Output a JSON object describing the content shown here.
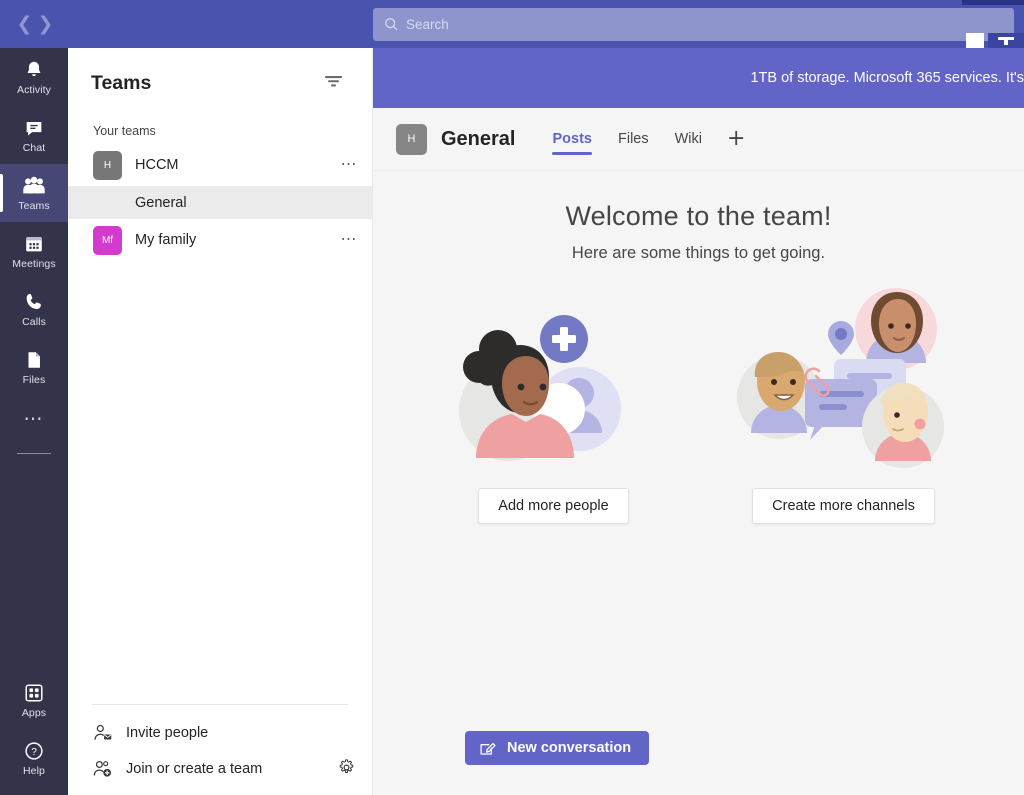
{
  "titlebar": {
    "back_icon": "chevron-left-icon",
    "forward_icon": "chevron-right-icon",
    "search_placeholder": "Search",
    "search_value": "",
    "search_icon": "search-icon"
  },
  "rail": {
    "items": [
      {
        "label": "Activity",
        "icon": "bell-icon",
        "selected": false
      },
      {
        "label": "Chat",
        "icon": "chat-bubble-icon",
        "selected": false
      },
      {
        "label": "Teams",
        "icon": "people-icon",
        "selected": true
      },
      {
        "label": "Meetings",
        "icon": "calendar-icon",
        "selected": false
      },
      {
        "label": "Calls",
        "icon": "phone-icon",
        "selected": false
      },
      {
        "label": "Files",
        "icon": "file-icon",
        "selected": false
      }
    ],
    "more_icon": "ellipsis-icon",
    "bottom_items": [
      {
        "label": "Apps",
        "icon": "apps-grid-icon"
      },
      {
        "label": "Help",
        "icon": "question-circle-icon"
      }
    ]
  },
  "panel": {
    "title": "Teams",
    "filter_icon": "filter-icon",
    "section_label": "Your teams",
    "teams": [
      {
        "name": "HCCM",
        "initials": "H",
        "avatar_color": "#777777",
        "overflow_icon": "ellipsis-icon",
        "channels": [
          {
            "name": "General",
            "selected": true
          }
        ]
      },
      {
        "name": "My family",
        "initials": "Mf",
        "avatar_color": "#d33bce",
        "overflow_icon": "ellipsis-icon",
        "channels": []
      }
    ],
    "footer": {
      "invite_label": "Invite people",
      "invite_icon": "person-add-mail-icon",
      "join_label": "Join or create a team",
      "join_icon": "people-add-icon",
      "settings_icon": "gear-icon"
    }
  },
  "main": {
    "banner": {
      "text": "1TB of storage. Microsoft 365 services. It's",
      "background": "#6264c7"
    },
    "channel": {
      "team_initials": "H",
      "name": "General",
      "tabs": [
        {
          "label": "Posts",
          "active": true
        },
        {
          "label": "Files",
          "active": false
        },
        {
          "label": "Wiki",
          "active": false
        }
      ],
      "add_tab_icon": "plus-icon"
    },
    "welcome": {
      "heading": "Welcome to the team!",
      "subheading": "Here are some things to get going."
    },
    "cards": [
      {
        "button_label": "Add more people",
        "art": "add-people-illustration"
      },
      {
        "button_label": "Create more channels",
        "art": "channels-chat-illustration"
      }
    ],
    "new_conversation": {
      "label": "New conversation",
      "icon": "compose-pencil-icon",
      "color": "#6264c7"
    }
  },
  "colors": {
    "titlebar": "#4a53ae",
    "rail": "#33344a",
    "rail_selected": "#464775",
    "accent": "#6264c7",
    "content_bg": "#f5f5f5"
  }
}
